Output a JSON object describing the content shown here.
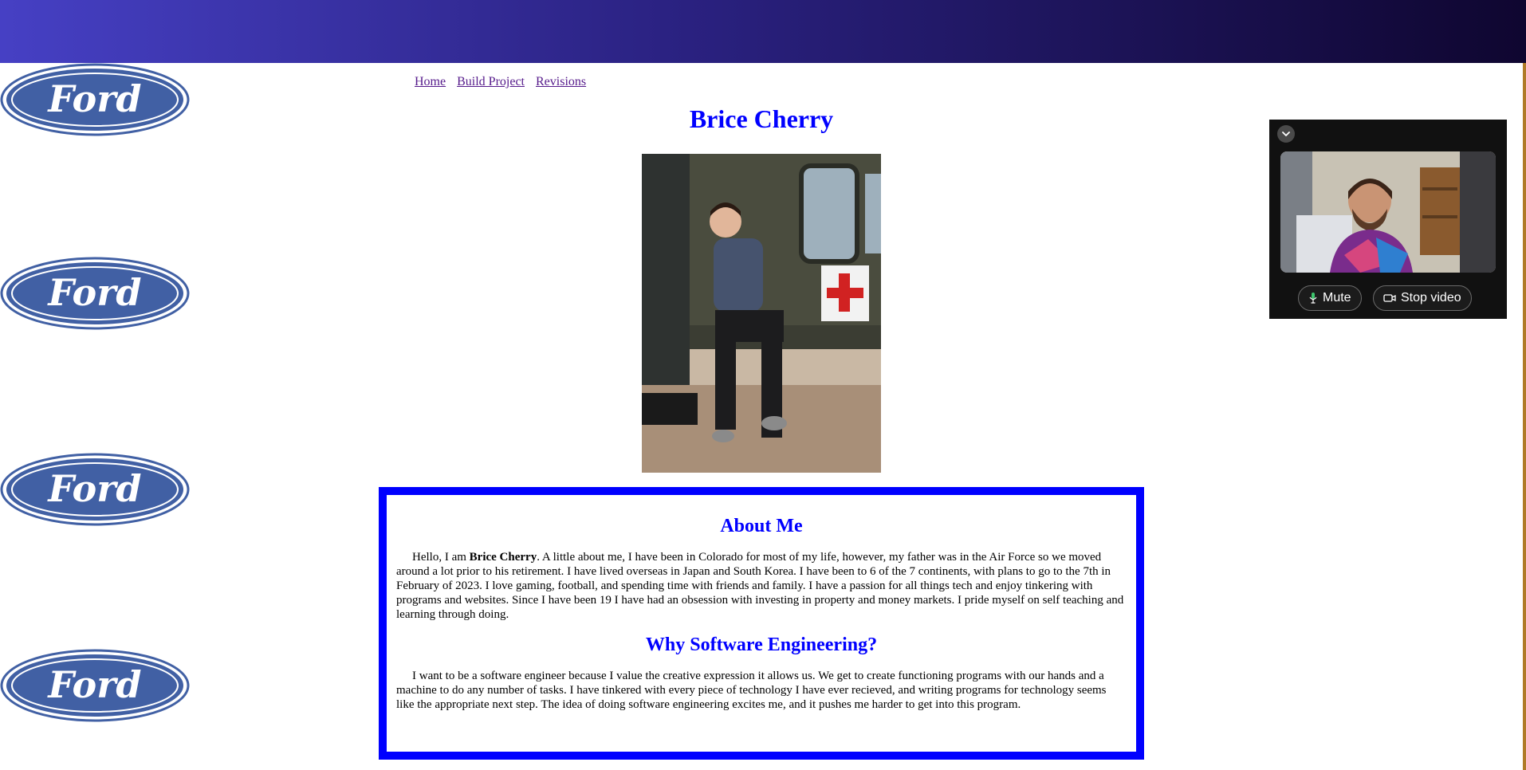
{
  "logos": [
    {
      "text": "Ford"
    },
    {
      "text": "Ford"
    },
    {
      "text": "Ford"
    },
    {
      "text": "Ford"
    }
  ],
  "nav": {
    "items": [
      "Home",
      "Build Project",
      "Revisions"
    ]
  },
  "title": "Brice Cherry",
  "about": {
    "heading": "About Me",
    "intro": "Hello, I am ",
    "name": "Brice Cherry",
    "body": ". A little about me, I have been in Colorado for most of my life, however, my father was in the Air Force so we moved around a lot prior to his retirement. I have lived overseas in Japan and South Korea. I have been to 6 of the 7 continents, with plans to go to the 7th in February of 2023. I love gaming, football, and spending time with friends and family. I have a passion for all things tech and enjoy tinkering with programs and websites. Since I have been 19 I have had an obsession with investing in property and money markets. I pride myself on self teaching and learning through doing."
  },
  "why": {
    "heading": "Why Software Engineering?",
    "body": "I want to be a software engineer because I value the creative expression it allows us. We get to create functioning programs with our hands and a machine to do any number of tasks. I have tinkered with every piece of technology I have ever recieved, and writing programs for technology seems like the appropriate next step. The idea of doing software engineering excites me, and it pushes me harder to get into this program."
  },
  "video_panel": {
    "mute_label": "Mute",
    "stop_video_label": "Stop video"
  },
  "colors": {
    "heading_blue": "#0000ff",
    "link_visited": "#551a8b",
    "ford_blue": "#4160a4"
  }
}
